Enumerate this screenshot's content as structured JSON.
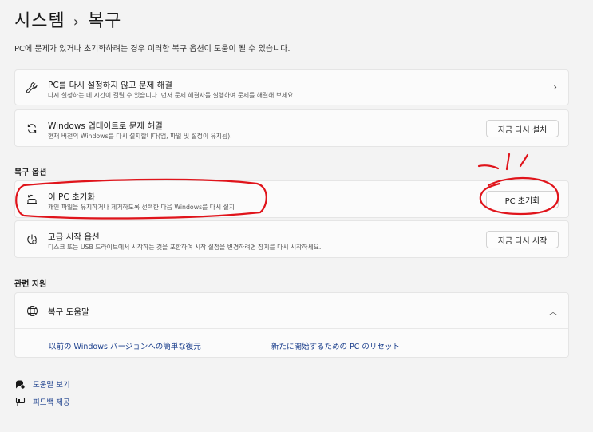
{
  "breadcrumb": {
    "parent": "시스템",
    "separator": "›",
    "current": "복구"
  },
  "subtitle": "PC에 문제가 있거나 초기화하려는 경우 이러한 복구 옵션이 도움이 될 수 있습니다.",
  "fixes": [
    {
      "title": "PC를 다시 설정하지 않고 문제 해결",
      "desc": "다시 설정하는 데 시간이 걸릴 수 있습니다. 먼저 문제 해결사를 실행하여 문제를 해결해 보세요.",
      "icon": "wrench-icon"
    },
    {
      "title": "Windows 업데이트로 문제 해결",
      "desc": "현재 버전의 Windows를 다시 설치합니다(앱, 파일 및 설정이 유지됨).",
      "icon": "refresh-icon",
      "button": "지금 다시 설치"
    }
  ],
  "recovery_options": {
    "heading": "복구 옵션",
    "items": [
      {
        "title": "이 PC 초기화",
        "desc": "개인 파일을 유지하거나 제거하도록 선택한 다음 Windows를 다시 설치",
        "button": "PC 초기화",
        "icon": "reset-pc-icon"
      },
      {
        "title": "고급 시작 옵션",
        "desc": "디스크 또는 USB 드라이브에서 시작하는 것을 포함하여 시작 설정을 변경하려면 장치를 다시 시작하세요.",
        "button": "지금 다시 시작",
        "icon": "advanced-startup-icon"
      }
    ]
  },
  "related": {
    "heading": "관련 지원",
    "title": "복구 도움말",
    "links": [
      "以前の Windows バージョンへの簡単な復元",
      "新たに開始するための PC のリセット"
    ]
  },
  "footer": {
    "help": "도움말 보기",
    "feedback": "피드백 제공"
  },
  "colors": {
    "background": "#f3f3f3",
    "card": "#fbfbfb",
    "link": "#1a3e8c",
    "annotation": "#e0141b"
  }
}
